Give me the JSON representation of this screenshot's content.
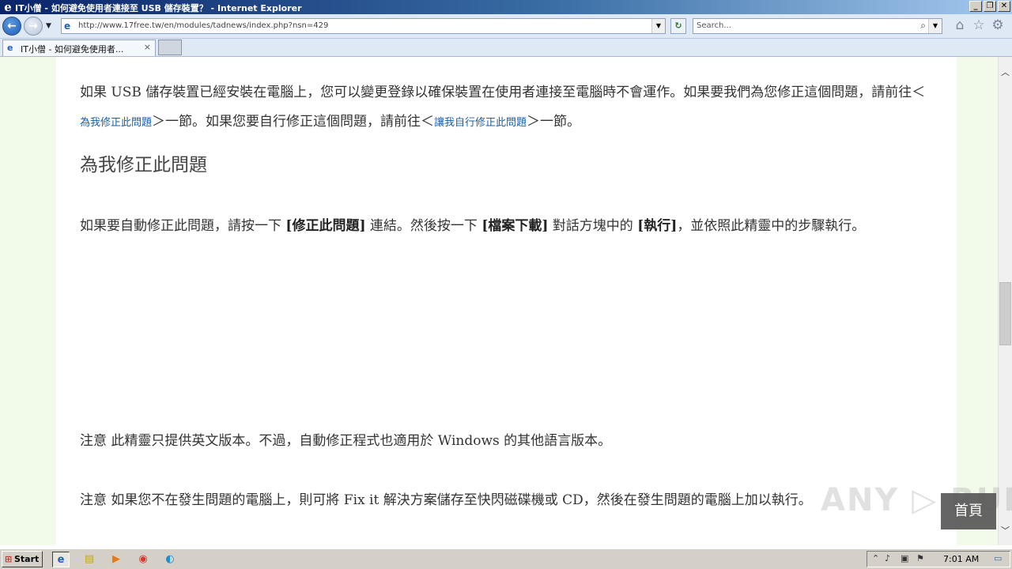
{
  "window": {
    "title": "IT小僧 - 如何避免使用者連接至 USB 儲存裝置？ - Internet Explorer",
    "minimize_label": "_",
    "restore_label": "❐",
    "close_label": "✕"
  },
  "nav": {
    "url": "http://www.17free.tw/en/modules/tadnews/index.php?nsn=429",
    "search_placeholder": "Search..."
  },
  "tabs": [
    {
      "label": "IT小僧 - 如何避免使用者...",
      "close": "×"
    }
  ],
  "content": {
    "para1_before": "如果 USB 儲存裝置已經安裝在電腦上，您可以變更登錄以確保裝置在使用者連接至電腦時不會運作。如果要我們為您修正這個問題，請前往＜",
    "para1_link1": "為我修正此問題",
    "para1_middle": "＞一節。如果您要自行修正這個問題，請前往＜",
    "para1_link2": "讓我自行修正此問題",
    "para1_after": "＞一節。",
    "heading": "為我修正此問題",
    "para2_t1": "如果要自動修正此問題，請按一下 ",
    "para2_b1": "[修正此問題]",
    "para2_t2": " 連結。然後按一下 ",
    "para2_b2": "[檔案下載]",
    "para2_t3": " 對話方塊中的 ",
    "para2_b3": "[執行]",
    "para2_t4": "，並依照此精靈中的步驟執行。",
    "note1": "注意 此精靈只提供英文版本。不過，自動修正程式也適用於 Windows 的其他語言版本。",
    "note2": "注意 如果您不在發生問題的電腦上，則可將 Fix it 解決方案儲存至快閃磁碟機或 CD，然後在發生問題的電腦上加以執行。"
  },
  "home_button": "首頁",
  "watermark": "ANY ▷ RUN",
  "taskbar": {
    "start_label": "Start",
    "clock": "7:01 AM"
  }
}
